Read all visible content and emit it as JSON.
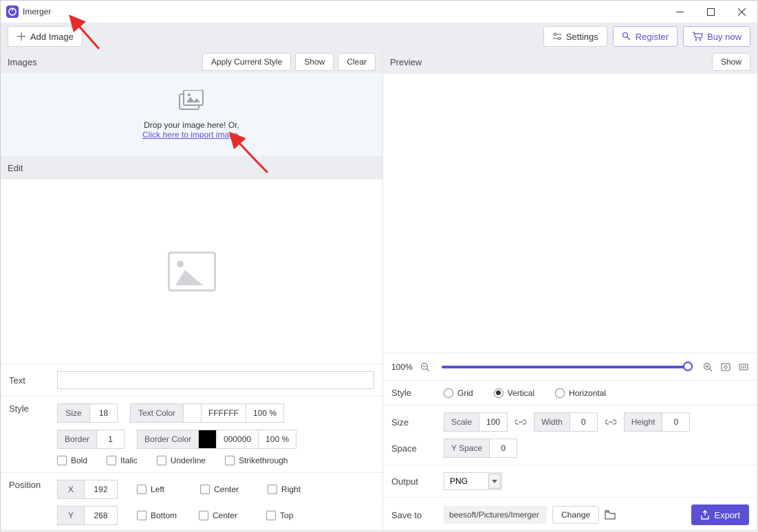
{
  "app": {
    "title": "Imerger"
  },
  "toolbar": {
    "add_image": "Add Image",
    "settings": "Settings",
    "register": "Register",
    "buy_now": "Buy now"
  },
  "left": {
    "images_label": "Images",
    "apply_style": "Apply Current Style",
    "show": "Show",
    "clear": "Clear",
    "drop_text": "Drop your image here! Or,",
    "import_link": "Click here to import image.",
    "edit_label": "Edit"
  },
  "text_section": {
    "label": "Text",
    "value": ""
  },
  "style_section": {
    "label": "Style",
    "size_label": "Size",
    "size_value": "18",
    "textcolor_label": "Text Color",
    "textcolor_value": "FFFFFF",
    "textcolor_pct": "100 %",
    "border_label": "Border",
    "border_value": "1",
    "bordercolor_label": "Border Color",
    "bordercolor_value": "000000",
    "bordercolor_pct": "100 %",
    "bold": "Bold",
    "italic": "Italic",
    "underline": "Underline",
    "strike": "Strikethrough"
  },
  "position_section": {
    "label": "Position",
    "x_label": "X",
    "x_value": "192",
    "y_label": "Y",
    "y_value": "268",
    "left": "Left",
    "bottom": "Bottom",
    "center1": "Center",
    "center2": "Center",
    "right": "Right",
    "top": "Top"
  },
  "preview": {
    "label": "Preview",
    "show": "Show",
    "zoom": "100%"
  },
  "r_style": {
    "label": "Style",
    "grid": "Grid",
    "vertical": "Vertical",
    "horizontal": "Horizontal",
    "selected": "vertical"
  },
  "r_size": {
    "label": "Size",
    "scale_label": "Scale",
    "scale_value": "100",
    "width_label": "Width",
    "width_value": "0",
    "height_label": "Height",
    "height_value": "0"
  },
  "r_space": {
    "label": "Space",
    "yspace_label": "Y Space",
    "yspace_value": "0"
  },
  "r_output": {
    "label": "Output",
    "format": "PNG"
  },
  "r_saveto": {
    "label": "Save to",
    "path": "beesoft/Pictures/Imerger",
    "change": "Change",
    "export": "Export"
  }
}
